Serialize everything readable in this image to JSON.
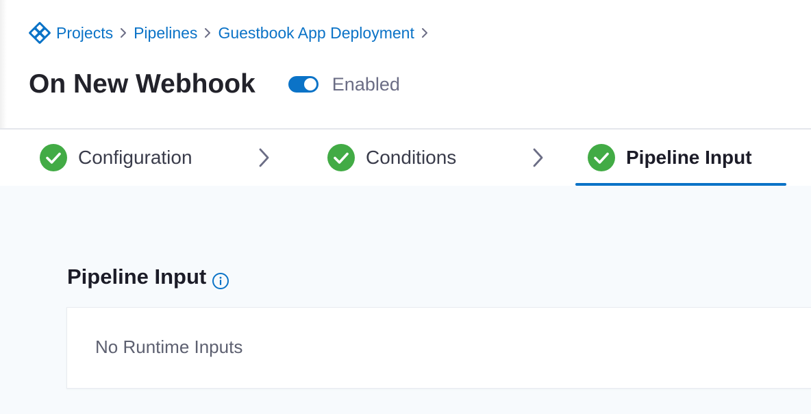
{
  "breadcrumb": {
    "logo_icon": "harness-logo-icon",
    "items": [
      {
        "label": "Projects"
      },
      {
        "label": "Pipelines"
      },
      {
        "label": "Guestbook App Deployment"
      }
    ]
  },
  "header": {
    "title": "On New Webhook",
    "toggle": {
      "state": "on",
      "label": "Enabled"
    }
  },
  "tabs": [
    {
      "label": "Configuration",
      "status": "complete"
    },
    {
      "label": "Conditions",
      "status": "complete"
    },
    {
      "label": "Pipeline Input",
      "status": "complete",
      "active": true
    }
  ],
  "main": {
    "section_title": "Pipeline Input",
    "empty_message": "No Runtime Inputs"
  },
  "colors": {
    "accent": "#0b73c7",
    "success": "#42ab45",
    "content_bg": "#f7fafd"
  }
}
